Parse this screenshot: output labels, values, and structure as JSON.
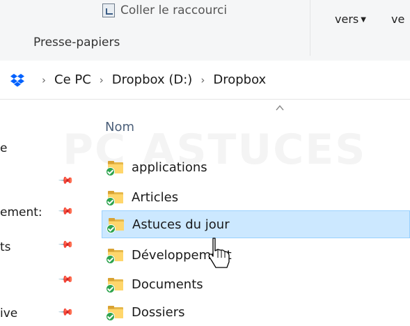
{
  "ribbon": {
    "coller_raccourci": "Coller le raccourci",
    "presse_papiers": "Presse-papiers",
    "vers_1": "vers",
    "vers_2": "ve"
  },
  "address": {
    "crumbs": [
      "Ce PC",
      "Dropbox (D:)",
      "Dropbox"
    ]
  },
  "nav": {
    "items": [
      "e",
      "ement:",
      "ts",
      "ive"
    ]
  },
  "filelist": {
    "column_name": "Nom",
    "files": [
      {
        "name": "applications",
        "selected": false
      },
      {
        "name": "Articles",
        "selected": false
      },
      {
        "name": "Astuces du jour",
        "selected": true
      },
      {
        "name": "Développement",
        "selected": false
      },
      {
        "name": "Documents",
        "selected": false
      },
      {
        "name": "Dossiers",
        "selected": false
      }
    ]
  },
  "watermark": "PC ASTUCES",
  "colors": {
    "selection_bg": "#cce8ff",
    "selection_border": "#99d1ff",
    "folder": "#ffd66b",
    "sync_badge": "#2ea44f",
    "dropbox": "#0061fe"
  }
}
